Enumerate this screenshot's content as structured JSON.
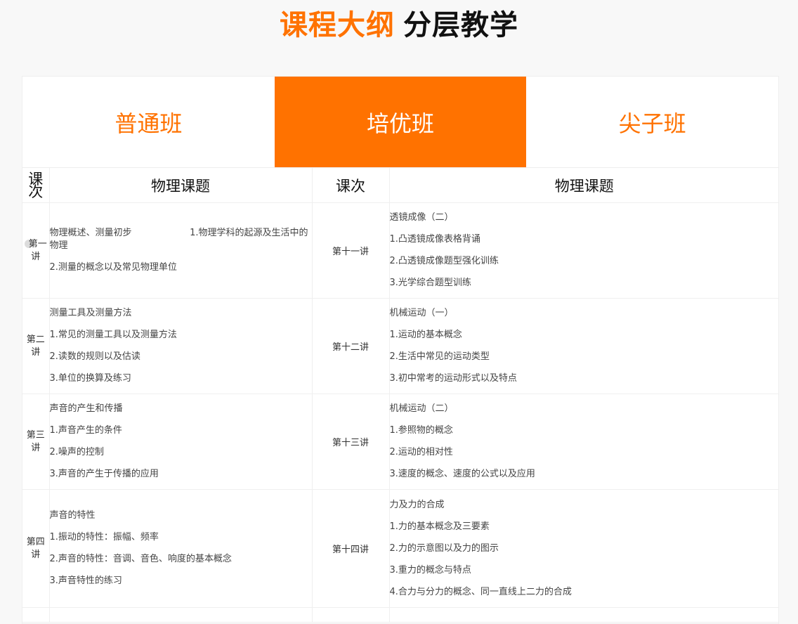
{
  "heading": {
    "accent": "课程大纲",
    "main": "分层教学"
  },
  "tabs": [
    {
      "label": "普通班",
      "active": false
    },
    {
      "label": "培优班",
      "active": true
    },
    {
      "label": "尖子班",
      "active": false
    }
  ],
  "colors": {
    "accent": "#ff7200",
    "background": "#f8f8f8",
    "table_border": "#efefef"
  },
  "table": {
    "headers": {
      "lesson_left": "课次",
      "topic_left": "物理课题",
      "lesson_right": "课次",
      "topic_right": "物理课题"
    },
    "rows": [
      {
        "left_lesson": "第一讲",
        "left_lines": [
          "物理概述、测量初步                    1.物理学科的起源及生活中的物理",
          "2.测量的概念以及常见物理单位"
        ],
        "right_lesson": "第十一讲",
        "right_lines": [
          "透镜成像（二）",
          "1.凸透镜成像表格背诵",
          "2.凸透镜成像题型强化训练",
          "3.光学综合题型训练"
        ]
      },
      {
        "left_lesson": "第二讲",
        "left_lines": [
          "测量工具及测量方法",
          "1.常见的测量工具以及测量方法",
          "2.读数的规则以及估读",
          "3.单位的换算及练习"
        ],
        "right_lesson": "第十二讲",
        "right_lines": [
          "机械运动（一）",
          "1.运动的基本概念",
          "2.生活中常见的运动类型",
          "3.初中常考的运动形式以及特点"
        ]
      },
      {
        "left_lesson": "第三讲",
        "left_lines": [
          "声音的产生和传播",
          "1.声音产生的条件",
          "2.噪声的控制",
          "3.声音的产生于传播的应用"
        ],
        "right_lesson": "第十三讲",
        "right_lines": [
          "机械运动（二）",
          "1.参照物的概念",
          "2.运动的相对性",
          "3.速度的概念、速度的公式以及应用"
        ]
      },
      {
        "left_lesson": "第四讲",
        "left_lines": [
          "声音的特性",
          "1.振动的特性：振幅、频率",
          "2.声音的特性：音调、音色、响度的基本概念",
          "3.声音特性的练习"
        ],
        "right_lesson": "第十四讲",
        "right_lines": [
          "力及力的合成",
          "1.力的基本概念及三要素",
          "2.力的示意图以及力的图示",
          "3.重力的概念与特点",
          "4.合力与分力的概念、同一直线上二力的合成"
        ]
      }
    ]
  }
}
